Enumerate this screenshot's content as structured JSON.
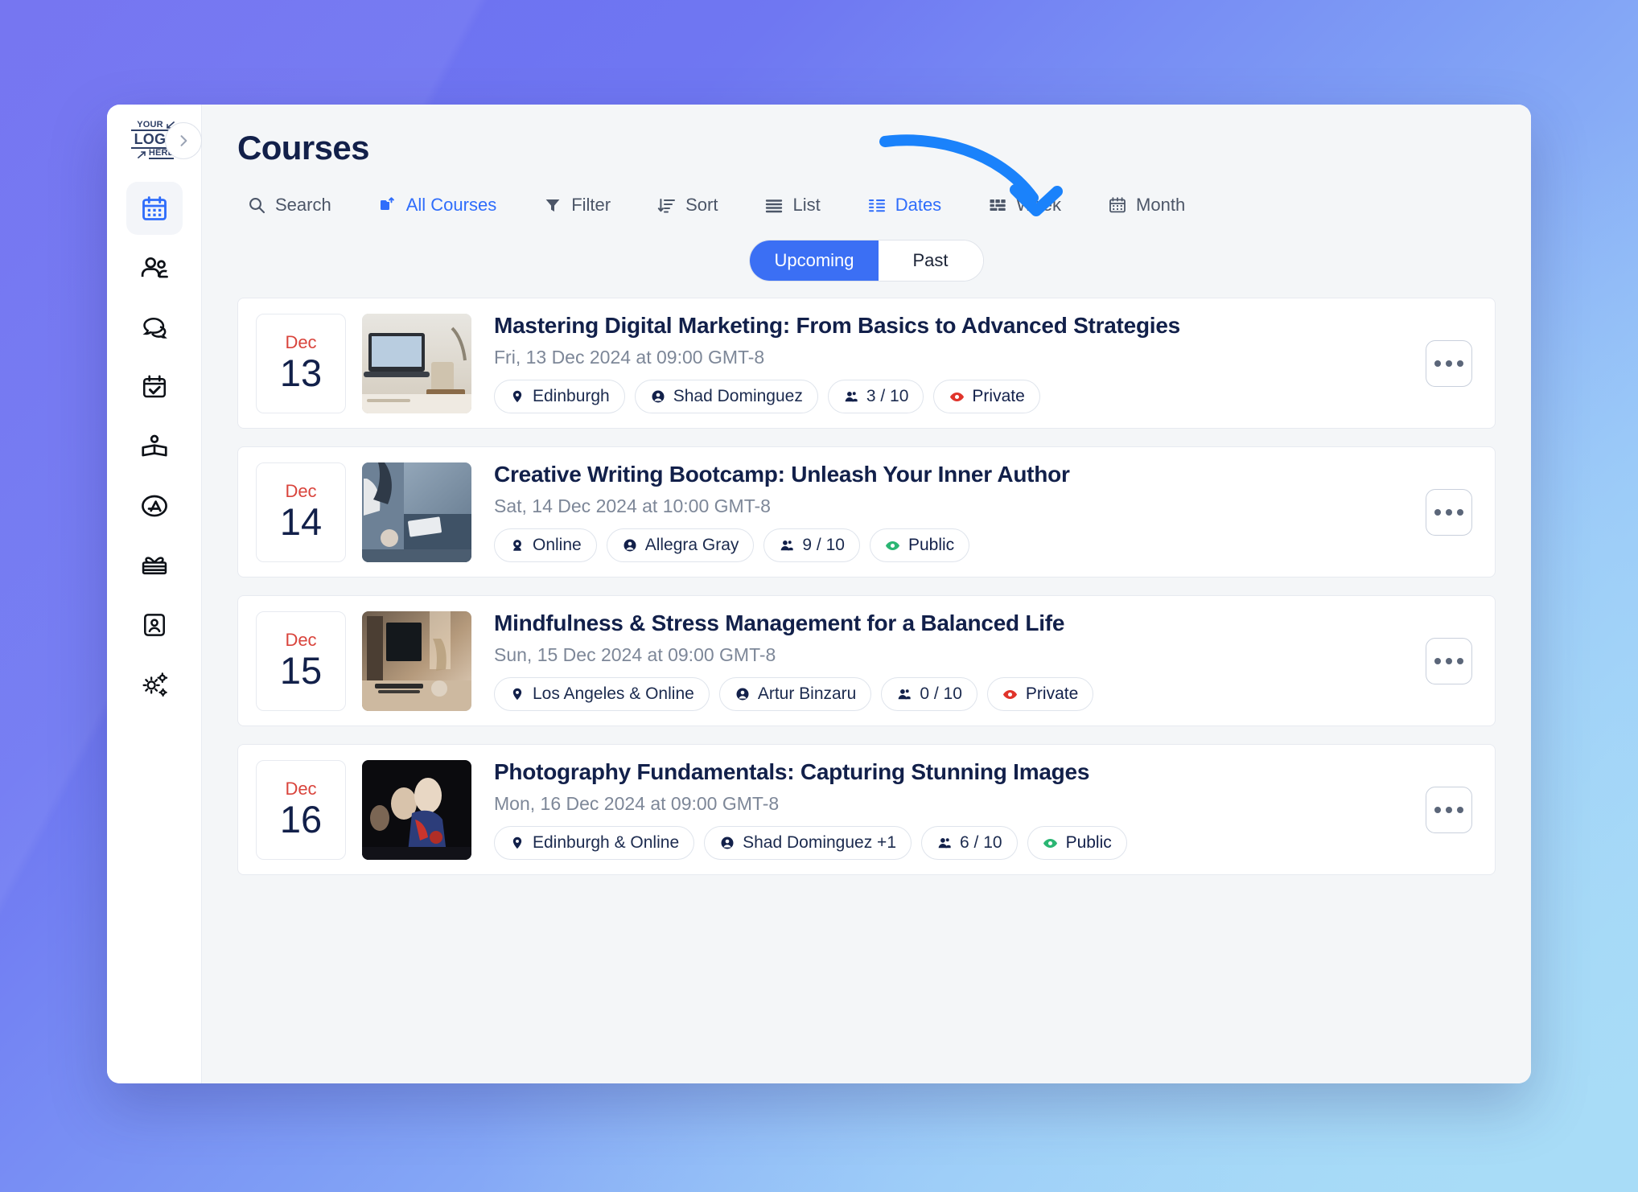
{
  "branding": {
    "logo_line1": "YOUR",
    "logo_line2": "LOGO",
    "logo_line3": "HERE",
    "accent_blue": "#2f6dfb",
    "title_navy": "#12204a",
    "red": "#d9443c",
    "green": "#2bb673"
  },
  "sidebar": {
    "collapse_icon": "chevron-right-icon",
    "items": [
      {
        "icon": "calendar-icon",
        "name": "calendar",
        "active": true
      },
      {
        "icon": "people-icon",
        "name": "people",
        "active": false
      },
      {
        "icon": "chat-bubbles-icon",
        "name": "messages",
        "active": false
      },
      {
        "icon": "calendar-check-icon",
        "name": "tasks",
        "active": false
      },
      {
        "icon": "open-book-icon",
        "name": "courses",
        "active": false
      },
      {
        "icon": "app-store-icon",
        "name": "apps",
        "active": false
      },
      {
        "icon": "gift-icon",
        "name": "rewards",
        "active": false
      },
      {
        "icon": "id-card-icon",
        "name": "profile",
        "active": false
      },
      {
        "icon": "gears-icon",
        "name": "settings",
        "active": false
      }
    ]
  },
  "header": {
    "title": "Courses"
  },
  "toolbar": {
    "items": [
      {
        "label": "Search",
        "icon": "search-icon",
        "accent": false
      },
      {
        "label": "All Courses",
        "icon": "all-courses-icon",
        "accent": true
      },
      {
        "label": "Filter",
        "icon": "filter-icon",
        "accent": false
      },
      {
        "label": "Sort",
        "icon": "sort-icon",
        "accent": false
      },
      {
        "label": "List",
        "icon": "list-icon",
        "accent": false
      },
      {
        "label": "Dates",
        "icon": "dates-icon",
        "accent": true
      },
      {
        "label": "Week",
        "icon": "week-grid-icon",
        "accent": false
      },
      {
        "label": "Month",
        "icon": "month-calendar-icon",
        "accent": false
      }
    ]
  },
  "segmented": {
    "options": [
      "Upcoming",
      "Past"
    ],
    "selected": "Upcoming"
  },
  "annotation": {
    "type": "curved-arrow",
    "color": "#1a82fb",
    "points_to": "Dates"
  },
  "courses": [
    {
      "date_month": "Dec",
      "date_day": "13",
      "title": "Mastering Digital Marketing: From Basics to Advanced Strategies",
      "when": "Fri, 13 Dec 2024 at 09:00 GMT-8",
      "thumb": "laptop-desk-photo",
      "pills": [
        {
          "label": "Edinburgh",
          "icon": "location-pin-icon",
          "tone": "default"
        },
        {
          "label": "Shad Dominguez",
          "icon": "person-circle-icon",
          "tone": "default"
        },
        {
          "label": "3 / 10",
          "icon": "attendees-icon",
          "tone": "default"
        },
        {
          "label": "Private",
          "icon": "eye-icon",
          "tone": "red"
        }
      ],
      "more_label": "•••"
    },
    {
      "date_month": "Dec",
      "date_day": "14",
      "title": "Creative Writing Bootcamp: Unleash Your Inner Author",
      "when": "Sat, 14 Dec 2024 at 10:00 GMT-8",
      "thumb": "writing-workshop-photo",
      "pills": [
        {
          "label": "Online",
          "icon": "webcam-icon",
          "tone": "default"
        },
        {
          "label": "Allegra Gray",
          "icon": "person-circle-icon",
          "tone": "default"
        },
        {
          "label": "9 / 10",
          "icon": "attendees-icon",
          "tone": "default"
        },
        {
          "label": "Public",
          "icon": "eye-icon",
          "tone": "green"
        }
      ],
      "more_label": "•••"
    },
    {
      "date_month": "Dec",
      "date_day": "15",
      "title": "Mindfulness & Stress Management for a Balanced Life",
      "when": "Sun, 15 Dec 2024 at 09:00 GMT-8",
      "thumb": "interior-desk-photo",
      "pills": [
        {
          "label": "Los Angeles & Online",
          "icon": "location-pin-icon",
          "tone": "default"
        },
        {
          "label": "Artur Binzaru",
          "icon": "person-circle-icon",
          "tone": "default"
        },
        {
          "label": "0 / 10",
          "icon": "attendees-icon",
          "tone": "default"
        },
        {
          "label": "Private",
          "icon": "eye-icon",
          "tone": "red"
        }
      ],
      "more_label": "•••"
    },
    {
      "date_month": "Dec",
      "date_day": "16",
      "title": "Photography Fundamentals: Capturing Stunning Images",
      "when": "Mon, 16 Dec 2024 at 09:00 GMT-8",
      "thumb": "crowd-night-photo",
      "pills": [
        {
          "label": "Edinburgh & Online",
          "icon": "location-pin-icon",
          "tone": "default"
        },
        {
          "label": "Shad Dominguez +1",
          "icon": "person-circle-icon",
          "tone": "default"
        },
        {
          "label": "6 / 10",
          "icon": "attendees-icon",
          "tone": "default"
        },
        {
          "label": "Public",
          "icon": "eye-icon",
          "tone": "green"
        }
      ],
      "more_label": "•••"
    }
  ]
}
